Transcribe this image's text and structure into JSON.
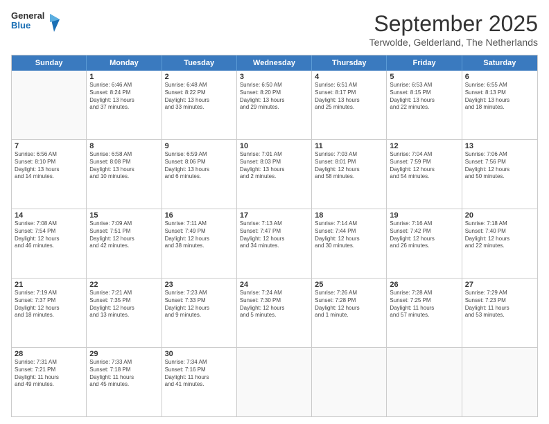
{
  "header": {
    "logo_general": "General",
    "logo_blue": "Blue",
    "month_title": "September 2025",
    "subtitle": "Terwolde, Gelderland, The Netherlands"
  },
  "days": [
    "Sunday",
    "Monday",
    "Tuesday",
    "Wednesday",
    "Thursday",
    "Friday",
    "Saturday"
  ],
  "rows": [
    [
      {
        "num": "",
        "empty": true
      },
      {
        "num": "1",
        "lines": [
          "Sunrise: 6:46 AM",
          "Sunset: 8:24 PM",
          "Daylight: 13 hours",
          "and 37 minutes."
        ]
      },
      {
        "num": "2",
        "lines": [
          "Sunrise: 6:48 AM",
          "Sunset: 8:22 PM",
          "Daylight: 13 hours",
          "and 33 minutes."
        ]
      },
      {
        "num": "3",
        "lines": [
          "Sunrise: 6:50 AM",
          "Sunset: 8:20 PM",
          "Daylight: 13 hours",
          "and 29 minutes."
        ]
      },
      {
        "num": "4",
        "lines": [
          "Sunrise: 6:51 AM",
          "Sunset: 8:17 PM",
          "Daylight: 13 hours",
          "and 25 minutes."
        ]
      },
      {
        "num": "5",
        "lines": [
          "Sunrise: 6:53 AM",
          "Sunset: 8:15 PM",
          "Daylight: 13 hours",
          "and 22 minutes."
        ]
      },
      {
        "num": "6",
        "lines": [
          "Sunrise: 6:55 AM",
          "Sunset: 8:13 PM",
          "Daylight: 13 hours",
          "and 18 minutes."
        ]
      }
    ],
    [
      {
        "num": "7",
        "lines": [
          "Sunrise: 6:56 AM",
          "Sunset: 8:10 PM",
          "Daylight: 13 hours",
          "and 14 minutes."
        ]
      },
      {
        "num": "8",
        "lines": [
          "Sunrise: 6:58 AM",
          "Sunset: 8:08 PM",
          "Daylight: 13 hours",
          "and 10 minutes."
        ]
      },
      {
        "num": "9",
        "lines": [
          "Sunrise: 6:59 AM",
          "Sunset: 8:06 PM",
          "Daylight: 13 hours",
          "and 6 minutes."
        ]
      },
      {
        "num": "10",
        "lines": [
          "Sunrise: 7:01 AM",
          "Sunset: 8:03 PM",
          "Daylight: 13 hours",
          "and 2 minutes."
        ]
      },
      {
        "num": "11",
        "lines": [
          "Sunrise: 7:03 AM",
          "Sunset: 8:01 PM",
          "Daylight: 12 hours",
          "and 58 minutes."
        ]
      },
      {
        "num": "12",
        "lines": [
          "Sunrise: 7:04 AM",
          "Sunset: 7:59 PM",
          "Daylight: 12 hours",
          "and 54 minutes."
        ]
      },
      {
        "num": "13",
        "lines": [
          "Sunrise: 7:06 AM",
          "Sunset: 7:56 PM",
          "Daylight: 12 hours",
          "and 50 minutes."
        ]
      }
    ],
    [
      {
        "num": "14",
        "lines": [
          "Sunrise: 7:08 AM",
          "Sunset: 7:54 PM",
          "Daylight: 12 hours",
          "and 46 minutes."
        ]
      },
      {
        "num": "15",
        "lines": [
          "Sunrise: 7:09 AM",
          "Sunset: 7:51 PM",
          "Daylight: 12 hours",
          "and 42 minutes."
        ]
      },
      {
        "num": "16",
        "lines": [
          "Sunrise: 7:11 AM",
          "Sunset: 7:49 PM",
          "Daylight: 12 hours",
          "and 38 minutes."
        ]
      },
      {
        "num": "17",
        "lines": [
          "Sunrise: 7:13 AM",
          "Sunset: 7:47 PM",
          "Daylight: 12 hours",
          "and 34 minutes."
        ]
      },
      {
        "num": "18",
        "lines": [
          "Sunrise: 7:14 AM",
          "Sunset: 7:44 PM",
          "Daylight: 12 hours",
          "and 30 minutes."
        ]
      },
      {
        "num": "19",
        "lines": [
          "Sunrise: 7:16 AM",
          "Sunset: 7:42 PM",
          "Daylight: 12 hours",
          "and 26 minutes."
        ]
      },
      {
        "num": "20",
        "lines": [
          "Sunrise: 7:18 AM",
          "Sunset: 7:40 PM",
          "Daylight: 12 hours",
          "and 22 minutes."
        ]
      }
    ],
    [
      {
        "num": "21",
        "lines": [
          "Sunrise: 7:19 AM",
          "Sunset: 7:37 PM",
          "Daylight: 12 hours",
          "and 18 minutes."
        ]
      },
      {
        "num": "22",
        "lines": [
          "Sunrise: 7:21 AM",
          "Sunset: 7:35 PM",
          "Daylight: 12 hours",
          "and 13 minutes."
        ]
      },
      {
        "num": "23",
        "lines": [
          "Sunrise: 7:23 AM",
          "Sunset: 7:33 PM",
          "Daylight: 12 hours",
          "and 9 minutes."
        ]
      },
      {
        "num": "24",
        "lines": [
          "Sunrise: 7:24 AM",
          "Sunset: 7:30 PM",
          "Daylight: 12 hours",
          "and 5 minutes."
        ]
      },
      {
        "num": "25",
        "lines": [
          "Sunrise: 7:26 AM",
          "Sunset: 7:28 PM",
          "Daylight: 12 hours",
          "and 1 minute."
        ]
      },
      {
        "num": "26",
        "lines": [
          "Sunrise: 7:28 AM",
          "Sunset: 7:25 PM",
          "Daylight: 11 hours",
          "and 57 minutes."
        ]
      },
      {
        "num": "27",
        "lines": [
          "Sunrise: 7:29 AM",
          "Sunset: 7:23 PM",
          "Daylight: 11 hours",
          "and 53 minutes."
        ]
      }
    ],
    [
      {
        "num": "28",
        "lines": [
          "Sunrise: 7:31 AM",
          "Sunset: 7:21 PM",
          "Daylight: 11 hours",
          "and 49 minutes."
        ]
      },
      {
        "num": "29",
        "lines": [
          "Sunrise: 7:33 AM",
          "Sunset: 7:18 PM",
          "Daylight: 11 hours",
          "and 45 minutes."
        ]
      },
      {
        "num": "30",
        "lines": [
          "Sunrise: 7:34 AM",
          "Sunset: 7:16 PM",
          "Daylight: 11 hours",
          "and 41 minutes."
        ]
      },
      {
        "num": "",
        "empty": true
      },
      {
        "num": "",
        "empty": true
      },
      {
        "num": "",
        "empty": true
      },
      {
        "num": "",
        "empty": true
      }
    ]
  ]
}
